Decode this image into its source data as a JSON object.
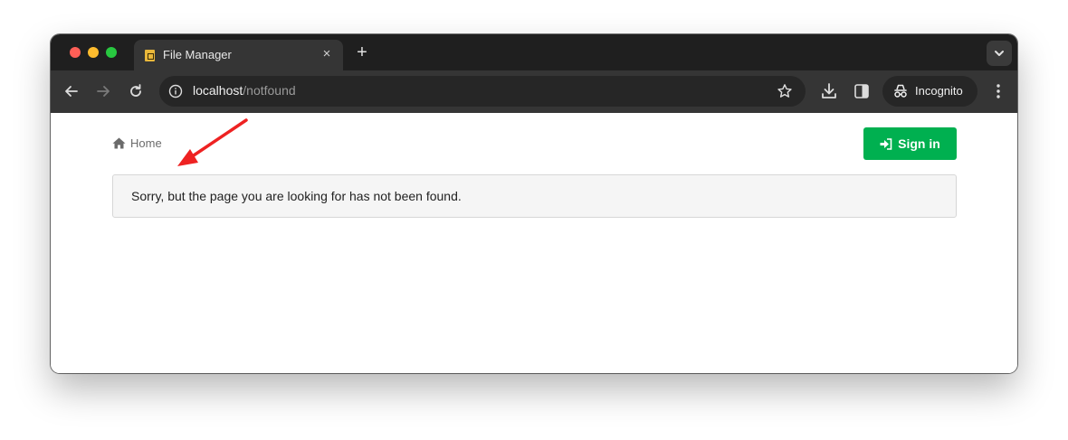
{
  "browser": {
    "tab": {
      "title": "File Manager",
      "close_glyph": "×",
      "favicon": "file-manager-favicon"
    },
    "new_tab_glyph": "+",
    "address_bar": {
      "host": "localhost",
      "path": "/notfound"
    },
    "profile": {
      "label": "Incognito",
      "icon": "incognito-icon"
    },
    "icons": [
      "back-icon",
      "forward-icon",
      "reload-icon",
      "site-info-icon",
      "bookmark-star-icon",
      "download-icon",
      "side-panel-icon",
      "menu-icon",
      "tab-search-icon"
    ]
  },
  "page": {
    "breadcrumb": {
      "home_label": "Home",
      "icon": "home-icon"
    },
    "sign_in_button": {
      "label": "Sign in",
      "icon": "sign-in-icon"
    },
    "alert": {
      "message": "Sorry, but the page you are looking for has not been found."
    },
    "annotation": {
      "type": "red-arrow",
      "color": "#ee2222"
    }
  },
  "colors": {
    "accent_green": "#00b050",
    "chrome_dark": "#1f1f1f",
    "toolbar": "#353535"
  }
}
